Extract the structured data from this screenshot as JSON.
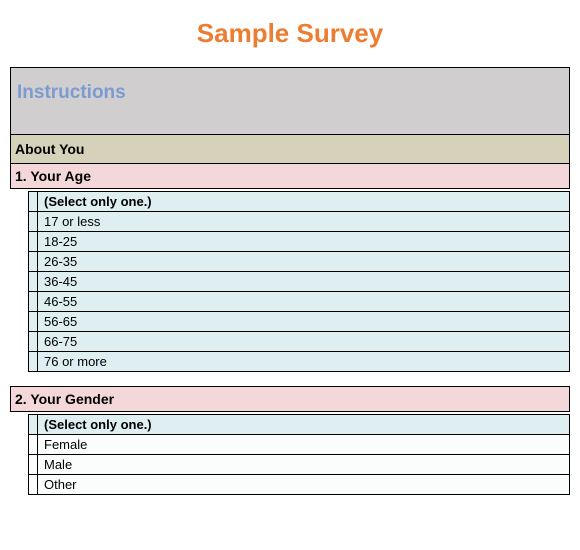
{
  "title": "Sample Survey",
  "instructions_heading": "Instructions",
  "about_heading": "About You",
  "q1": {
    "label": "1. Your Age",
    "hint": "(Select only one.)",
    "options": [
      "17 or less",
      "18-25",
      "26-35",
      "36-45",
      "46-55",
      "56-65",
      "66-75",
      "76 or more"
    ]
  },
  "q2": {
    "label": "2. Your Gender",
    "hint": "(Select only one.)",
    "options": [
      "Female",
      "Male",
      "Other"
    ]
  }
}
